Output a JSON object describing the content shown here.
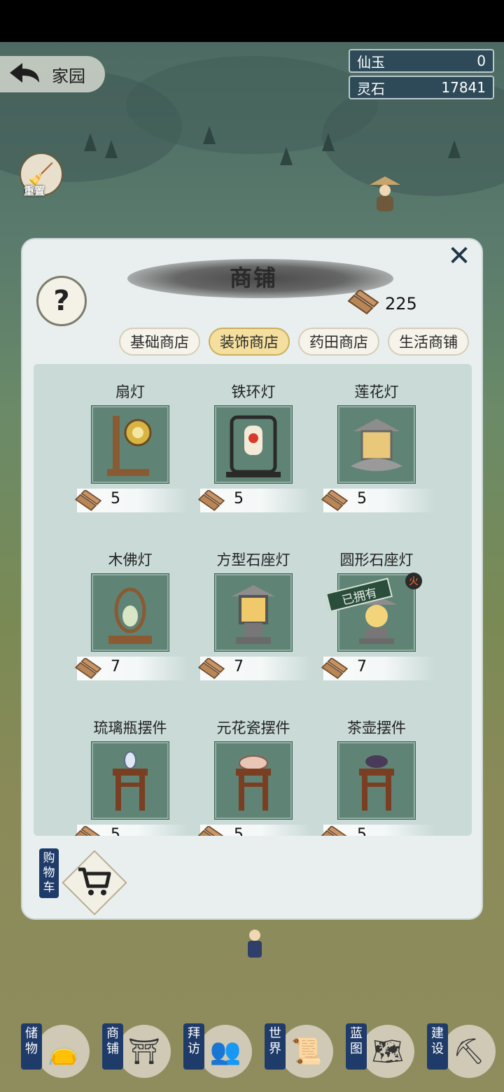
{
  "top": {
    "back_label": "家园",
    "currencies": [
      {
        "name": "仙玉",
        "value": "0"
      },
      {
        "name": "灵石",
        "value": "17841"
      }
    ],
    "broom_label": "重置"
  },
  "shop": {
    "title": "商铺",
    "help": "?",
    "wood_balance": "225",
    "tabs": [
      {
        "label": "基础商店",
        "active": false
      },
      {
        "label": "装饰商店",
        "active": true
      },
      {
        "label": "药田商店",
        "active": false
      },
      {
        "label": "生活商铺",
        "active": false
      }
    ],
    "items": [
      {
        "name": "扇灯",
        "price": "5"
      },
      {
        "name": "铁环灯",
        "price": "5"
      },
      {
        "name": "莲花灯",
        "price": "5"
      },
      {
        "name": "木佛灯",
        "price": "7"
      },
      {
        "name": "方型石座灯",
        "price": "7"
      },
      {
        "name": "圆形石座灯",
        "price": "7",
        "owned_label": "已拥有",
        "hot_label": "火"
      },
      {
        "name": "琉璃瓶摆件",
        "price": "5"
      },
      {
        "name": "元花瓷摆件",
        "price": "5"
      },
      {
        "name": "茶壶摆件",
        "price": "5"
      }
    ],
    "cart_label": "购物车"
  },
  "bottom_nav": [
    {
      "label": "储物",
      "icon": "bag-icon"
    },
    {
      "label": "商铺",
      "icon": "shop-icon"
    },
    {
      "label": "拜访",
      "icon": "visit-icon"
    },
    {
      "label": "世界",
      "icon": "scroll-icon"
    },
    {
      "label": "蓝图",
      "icon": "blueprint-icon"
    },
    {
      "label": "建设",
      "icon": "pickaxe-icon"
    }
  ],
  "colors": {
    "active_tab": "#f4df9e",
    "item_bg": "#5f8475",
    "nav_label_bg": "#1f3b6a"
  }
}
